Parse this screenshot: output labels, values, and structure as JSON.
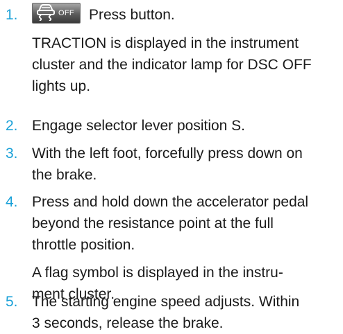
{
  "accent_color": "#1aa1d8",
  "steps": [
    {
      "number": "1.",
      "button": {
        "icon": "dsc-car-skid-icon",
        "label": "OFF"
      },
      "text": "Press button.",
      "note_lines": [
        "TRACTION is displayed in the instrument",
        "cluster and the indicator lamp for DSC OFF",
        "lights up."
      ]
    },
    {
      "number": "2.",
      "lines": [
        "Engage selector lever position S."
      ]
    },
    {
      "number": "3.",
      "lines": [
        "With the left foot, forcefully press down on",
        "the brake."
      ]
    },
    {
      "number": "4.",
      "lines": [
        "Press and hold down the accelerator pedal",
        "beyond the resistance point at the full",
        "throttle position."
      ],
      "note_lines": [
        "A flag symbol is displayed in the instru-",
        "ment cluster."
      ]
    },
    {
      "number": "5.",
      "lines": [
        "The starting engine speed adjusts. Within",
        "3 seconds, release the brake."
      ]
    }
  ]
}
